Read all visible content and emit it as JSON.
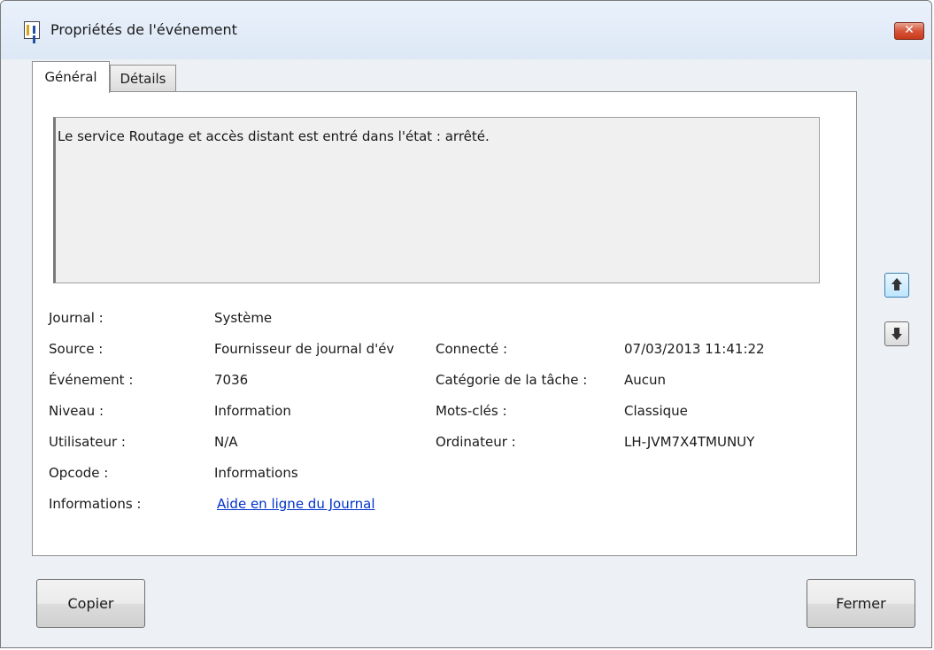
{
  "window": {
    "title": "Propriétés de l'événement",
    "close_glyph": "✕"
  },
  "tabs": [
    {
      "label": "Général",
      "active": true
    },
    {
      "label": "Détails",
      "active": false
    }
  ],
  "message": "Le service Routage et accès distant est entré dans l'état : arrêté.",
  "fields_left": [
    {
      "label": "Journal :",
      "value": "Système"
    },
    {
      "label": "Source :",
      "value": "Fournisseur de journal d'év"
    },
    {
      "label": "Événement :",
      "value": "7036"
    },
    {
      "label": "Niveau :",
      "value": "Information"
    },
    {
      "label": "Utilisateur :",
      "value": "N/A"
    },
    {
      "label": "Opcode :",
      "value": "Informations"
    },
    {
      "label": "Informations :",
      "value": "Aide en ligne du Journal"
    }
  ],
  "fields_right": [
    {
      "label": "Connecté :",
      "value": "07/03/2013 11:41:22"
    },
    {
      "label": "Catégorie de la tâche :",
      "value": "Aucun"
    },
    {
      "label": "Mots-clés :",
      "value": "Classique"
    },
    {
      "label": "Ordinateur :",
      "value": "LH-JVM7X4TMUNUY"
    }
  ],
  "buttons": {
    "copy": "Copier",
    "close": "Fermer"
  },
  "icons": {
    "title": "event-properties-icon",
    "up": "arrow-up-icon",
    "down": "arrow-down-icon"
  },
  "colors": {
    "link": "#0033cc",
    "close_button": "#c8391a"
  }
}
